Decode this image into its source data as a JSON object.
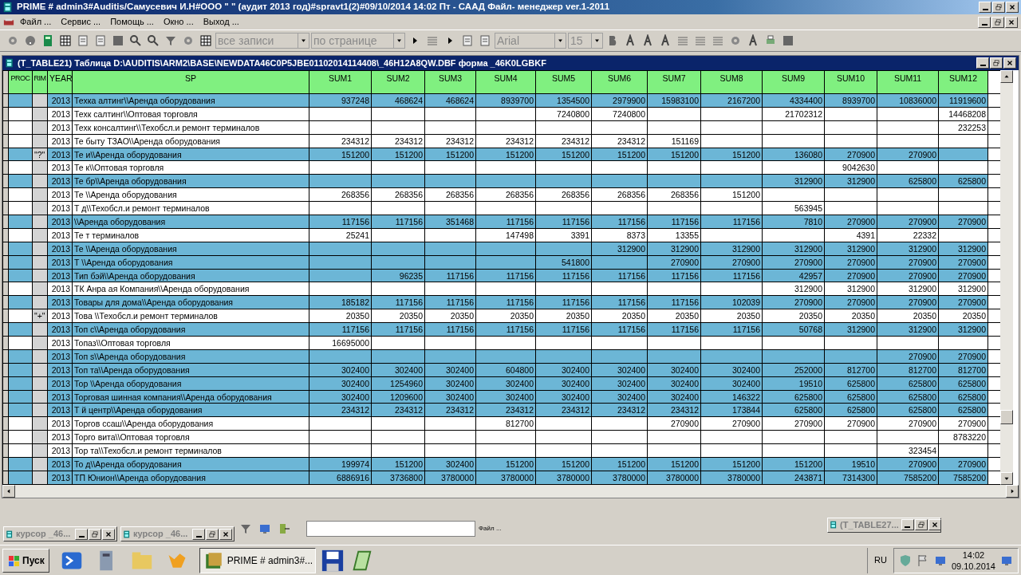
{
  "window": {
    "title": "PRIME # admin3#Auditis/Самусевич И.Н#ООО \"                    \" (аудит 2013 год)#spravt1(2)#09/10/2014 14:02 Пт - СААД Файл- менеджер ver.1-2011"
  },
  "menu": [
    "Файл ...",
    "Сервис ...",
    "Помощь ...",
    "Окно ...",
    "Выход ..."
  ],
  "toolbar": {
    "records": "все записи",
    "paging": "по странице",
    "font": "Arial",
    "size": "15"
  },
  "table_window": {
    "title": "(T_TABLE21)  Таблица D:\\AUDITIS\\ARM2\\BASE\\NEWDATA46C0P5JBE01102014114408\\_46H12A8QW.DBF форма _46K0LGBKF"
  },
  "table": {
    "columns": [
      "PROC",
      "RIM",
      "YEAR",
      "SP",
      "SUM1",
      "SUM2",
      "SUM3",
      "SUM4",
      "SUM5",
      "SUM6",
      "SUM7",
      "SUM8",
      "SUM9",
      "SUM10",
      "SUM11",
      "SUM12"
    ],
    "rows": [
      {
        "highlighted": true,
        "year": "2013",
        "sp": "Техка            алтинг\\\\Аренда оборудования",
        "sums": {
          "sum1": "937248",
          "sum2": "468624",
          "sum3": "468624",
          "sum4": "8939700",
          "sum5": "1354500",
          "sum6": "2979900",
          "sum7": "15983100",
          "sum8": "2167200",
          "sum9": "4334400",
          "sum10": "8939700",
          "sum11": "10836000",
          "sum12": "11919600"
        }
      },
      {
        "highlighted": false,
        "year": "2013",
        "sp": "Техк             салтинг\\\\Оптовая торговля",
        "sums": {
          "sum5": "7240800",
          "sum6": "7240800",
          "sum9": "21702312",
          "sum12": "14468208"
        }
      },
      {
        "highlighted": false,
        "year": "2013",
        "sp": "Техк    консалтинг\\\\Техобсл.и ремонт терминалов",
        "sums": {
          "sum12": "232253"
        }
      },
      {
        "highlighted": false,
        "year": "2013",
        "sp": "Те          быту  ТЗАО\\\\Аренда оборудования",
        "sums": {
          "sum1": "234312",
          "sum2": "234312",
          "sum3": "234312",
          "sum4": "234312",
          "sum5": "234312",
          "sum6": "234312",
          "sum7": "151169"
        }
      },
      {
        "highlighted": true,
        "rim": "\"?\"",
        "year": "2013",
        "sp": "Те            и\\\\Аренда оборудования",
        "sums": {
          "sum1": "151200",
          "sum2": "151200",
          "sum3": "151200",
          "sum4": "151200",
          "sum5": "151200",
          "sum6": "151200",
          "sum7": "151200",
          "sum8": "151200",
          "sum9": "136080",
          "sum10": "270900",
          "sum11": "270900"
        }
      },
      {
        "highlighted": false,
        "year": "2013",
        "sp": "Те                  к\\\\Оптовая торговля",
        "sums": {
          "sum10": "9042630"
        }
      },
      {
        "highlighted": true,
        "year": "2013",
        "sp": "Те            бр\\\\Аренда оборудования",
        "sums": {
          "sum9": "312900",
          "sum10": "312900",
          "sum11": "625800",
          "sum12": "625800"
        }
      },
      {
        "highlighted": false,
        "year": "2013",
        "sp": "Те             \\\\Аренда оборудования",
        "sums": {
          "sum1": "268356",
          "sum2": "268356",
          "sum3": "268356",
          "sum4": "268356",
          "sum5": "268356",
          "sum6": "268356",
          "sum7": "268356",
          "sum8": "151200"
        }
      },
      {
        "highlighted": false,
        "year": "2013",
        "sp": "Т           д\\\\Техобсл.и ремонт терминалов",
        "sums": {
          "sum9": "563945"
        }
      },
      {
        "highlighted": true,
        "year": "2013",
        "sp": "                 \\\\Аренда оборудования",
        "sums": {
          "sum1": "117156",
          "sum2": "117156",
          "sum3": "351468",
          "sum4": "117156",
          "sum5": "117156",
          "sum6": "117156",
          "sum7": "117156",
          "sum8": "117156",
          "sum9": "7810",
          "sum10": "270900",
          "sum11": "270900",
          "sum12": "270900"
        }
      },
      {
        "highlighted": false,
        "year": "2013",
        "sp": "Те                       т терминалов",
        "sums": {
          "sum1": "25241",
          "sum4": "147498",
          "sum5": "3391",
          "sum6": "8373",
          "sum7": "13355",
          "sum10": "4391",
          "sum11": "22332"
        }
      },
      {
        "highlighted": true,
        "year": "2013",
        "sp": "Те                    \\\\Аренда оборудования",
        "sums": {
          "sum6": "312900",
          "sum7": "312900",
          "sum8": "312900",
          "sum9": "312900",
          "sum10": "312900",
          "sum11": "312900",
          "sum12": "312900"
        }
      },
      {
        "highlighted": true,
        "year": "2013",
        "sp": "Т              \\\\Аренда оборудования",
        "sums": {
          "sum5": "541800",
          "sum7": "270900",
          "sum8": "270900",
          "sum9": "270900",
          "sum10": "270900",
          "sum11": "270900",
          "sum12": "270900"
        }
      },
      {
        "highlighted": true,
        "year": "2013",
        "sp": "Тип            бэй\\\\Аренда оборудования",
        "sums": {
          "sum2": "96235",
          "sum3": "117156",
          "sum4": "117156",
          "sum5": "117156",
          "sum6": "117156",
          "sum7": "117156",
          "sum8": "117156",
          "sum9": "42957",
          "sum10": "270900",
          "sum11": "270900",
          "sum12": "270900"
        }
      },
      {
        "highlighted": false,
        "year": "2013",
        "sp": "ТК Анра               ая Компания\\\\Аренда оборудования",
        "sums": {
          "sum9": "312900",
          "sum10": "312900",
          "sum11": "312900",
          "sum12": "312900"
        }
      },
      {
        "highlighted": true,
        "year": "2013",
        "sp": "Товары для дома\\\\Аренда оборудования",
        "sums": {
          "sum1": "185182",
          "sum2": "117156",
          "sum3": "117156",
          "sum4": "117156",
          "sum5": "117156",
          "sum6": "117156",
          "sum7": "117156",
          "sum8": "102039",
          "sum9": "270900",
          "sum10": "270900",
          "sum11": "270900",
          "sum12": "270900"
        }
      },
      {
        "highlighted": false,
        "rim": "\"+\"",
        "year": "2013",
        "sp": "Това               \\\\Техобсл.и ремонт терминалов",
        "sums": {
          "sum1": "20350",
          "sum2": "20350",
          "sum3": "20350",
          "sum4": "20350",
          "sum5": "20350",
          "sum6": "20350",
          "sum7": "20350",
          "sum8": "20350",
          "sum9": "20350",
          "sum10": "20350",
          "sum11": "20350",
          "sum12": "20350"
        }
      },
      {
        "highlighted": true,
        "year": "2013",
        "sp": "Топ          с\\\\Аренда оборудования",
        "sums": {
          "sum1": "117156",
          "sum2": "117156",
          "sum3": "117156",
          "sum4": "117156",
          "sum5": "117156",
          "sum6": "117156",
          "sum7": "117156",
          "sum8": "117156",
          "sum9": "50768",
          "sum10": "312900",
          "sum11": "312900",
          "sum12": "312900"
        }
      },
      {
        "highlighted": false,
        "year": "2013",
        "sp": "Топаз\\\\Оптовая торговля",
        "sums": {
          "sum1": "16695000"
        }
      },
      {
        "highlighted": true,
        "year": "2013",
        "sp": "Топ   s\\\\Аренда оборудования",
        "sums": {
          "sum11": "270900",
          "sum12": "270900"
        }
      },
      {
        "highlighted": true,
        "year": "2013",
        "sp": "Топ                та\\\\Аренда оборудования",
        "sums": {
          "sum1": "302400",
          "sum2": "302400",
          "sum3": "302400",
          "sum4": "604800",
          "sum5": "302400",
          "sum6": "302400",
          "sum7": "302400",
          "sum8": "302400",
          "sum9": "252000",
          "sum10": "812700",
          "sum11": "812700",
          "sum12": "812700"
        }
      },
      {
        "highlighted": true,
        "year": "2013",
        "sp": "Тор      \\\\Аренда оборудования",
        "sums": {
          "sum1": "302400",
          "sum2": "1254960",
          "sum3": "302400",
          "sum4": "302400",
          "sum5": "302400",
          "sum6": "302400",
          "sum7": "302400",
          "sum8": "302400",
          "sum9": "19510",
          "sum10": "625800",
          "sum11": "625800",
          "sum12": "625800"
        }
      },
      {
        "highlighted": true,
        "year": "2013",
        "sp": "Торговая шинная компания\\\\Аренда оборудования",
        "sums": {
          "sum1": "302400",
          "sum2": "1209600",
          "sum3": "302400",
          "sum4": "302400",
          "sum5": "302400",
          "sum6": "302400",
          "sum7": "302400",
          "sum8": "146322",
          "sum9": "625800",
          "sum10": "625800",
          "sum11": "625800",
          "sum12": "625800"
        }
      },
      {
        "highlighted": true,
        "year": "2013",
        "sp": "Т                      й центр\\\\Аренда оборудования",
        "sums": {
          "sum1": "234312",
          "sum2": "234312",
          "sum3": "234312",
          "sum4": "234312",
          "sum5": "234312",
          "sum6": "234312",
          "sum7": "234312",
          "sum8": "173844",
          "sum9": "625800",
          "sum10": "625800",
          "sum11": "625800",
          "sum12": "625800"
        }
      },
      {
        "highlighted": false,
        "year": "2013",
        "sp": "Торгов           ссаш\\\\Аренда оборудования",
        "sums": {
          "sum4": "812700",
          "sum7": "270900",
          "sum8": "270900",
          "sum9": "270900",
          "sum10": "270900",
          "sum11": "270900",
          "sum12": "270900"
        }
      },
      {
        "highlighted": false,
        "year": "2013",
        "sp": "Торго               вита\\\\Оптовая торговля",
        "sums": {
          "sum12": "8783220"
        }
      },
      {
        "highlighted": false,
        "year": "2013",
        "sp": "Тор                    та\\\\Техобсл.и ремонт терминалов",
        "sums": {
          "sum11": "323454"
        }
      },
      {
        "highlighted": true,
        "year": "2013",
        "sp": "То              д\\\\Аренда оборудования",
        "sums": {
          "sum1": "199974",
          "sum2": "151200",
          "sum3": "302400",
          "sum4": "151200",
          "sum5": "151200",
          "sum6": "151200",
          "sum7": "151200",
          "sum8": "151200",
          "sum9": "151200",
          "sum10": "19510",
          "sum11": "270900",
          "sum12": "270900"
        }
      },
      {
        "highlighted": true,
        "year": "2013",
        "sp": "ТП             Юнион\\\\Аренда оборудования",
        "sums": {
          "sum1": "6886916",
          "sum2": "3736800",
          "sum3": "3780000",
          "sum4": "3780000",
          "sum5": "3780000",
          "sum6": "3780000",
          "sum7": "3780000",
          "sum8": "3780000",
          "sum9": "243871",
          "sum10": "7314300",
          "sum11": "7585200",
          "sum12": "7585200"
        }
      }
    ]
  },
  "bottom": {
    "field_label": "Файл ...",
    "minimized": [
      "курсор _46...",
      "курсор _46..."
    ],
    "other_window": "(T_TABLE27..."
  },
  "taskbar": {
    "start": "Пуск",
    "task": "PRIME # admin3#...",
    "language": "RU",
    "time": "14:02",
    "date": "09.10.2014"
  }
}
